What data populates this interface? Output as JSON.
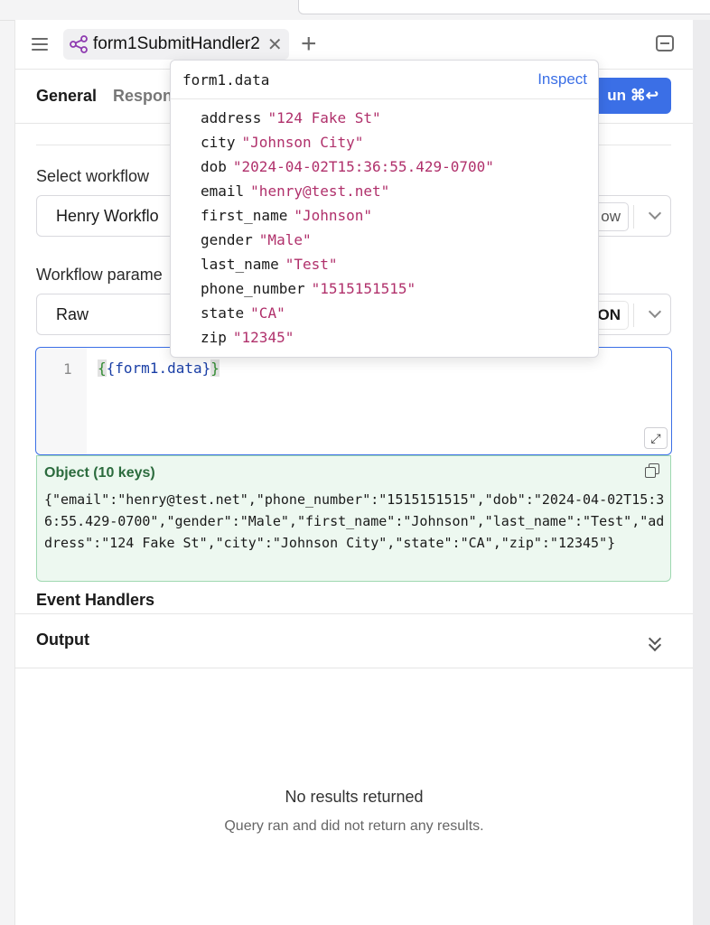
{
  "tab": {
    "name": "form1SubmitHandler2"
  },
  "subtabs": {
    "general": "General",
    "second": "Respon"
  },
  "run": {
    "label": "un ⌘↩"
  },
  "select_workflow": {
    "label": "Select workflow",
    "value": "Henry Workflo",
    "pill": "ow"
  },
  "workflow_params": {
    "label": "Workflow parame",
    "value": "Raw",
    "pill": "ON"
  },
  "editor": {
    "line_number": "1",
    "open": "{",
    "expr": "{form1.data}",
    "close": "}"
  },
  "result": {
    "title": "Object (10 keys)",
    "json": "{\"email\":\"henry@test.net\",\"phone_number\":\"1515151515\",\"dob\":\"2024-04-02T15:36:55.429-0700\",\"gender\":\"Male\",\"first_name\":\"Johnson\",\"last_name\":\"Test\",\"address\":\"124 Fake St\",\"city\":\"Johnson City\",\"state\":\"CA\",\"zip\":\"12345\"}"
  },
  "sections": {
    "event_handlers": "Event Handlers",
    "output": "Output"
  },
  "empty": {
    "title": "No results returned",
    "subtitle": "Query ran and did not return any results."
  },
  "popover": {
    "title": "form1.data",
    "inspect": "Inspect",
    "rows": [
      {
        "key": "address",
        "value": "\"124 Fake St\""
      },
      {
        "key": "city",
        "value": "\"Johnson City\""
      },
      {
        "key": "dob",
        "value": "\"2024-04-02T15:36:55.429-0700\""
      },
      {
        "key": "email",
        "value": "\"henry@test.net\""
      },
      {
        "key": "first_name",
        "value": "\"Johnson\""
      },
      {
        "key": "gender",
        "value": "\"Male\""
      },
      {
        "key": "last_name",
        "value": "\"Test\""
      },
      {
        "key": "phone_number",
        "value": "\"1515151515\""
      },
      {
        "key": "state",
        "value": "\"CA\""
      },
      {
        "key": "zip",
        "value": "\"12345\""
      }
    ]
  },
  "colors": {
    "accent": "#3b6fe6",
    "string_value": "#b0306b",
    "success_bg": "#edf8f0"
  },
  "icons": {
    "query": "workflow-share-icon",
    "close": "close-icon",
    "add": "plus-icon"
  }
}
